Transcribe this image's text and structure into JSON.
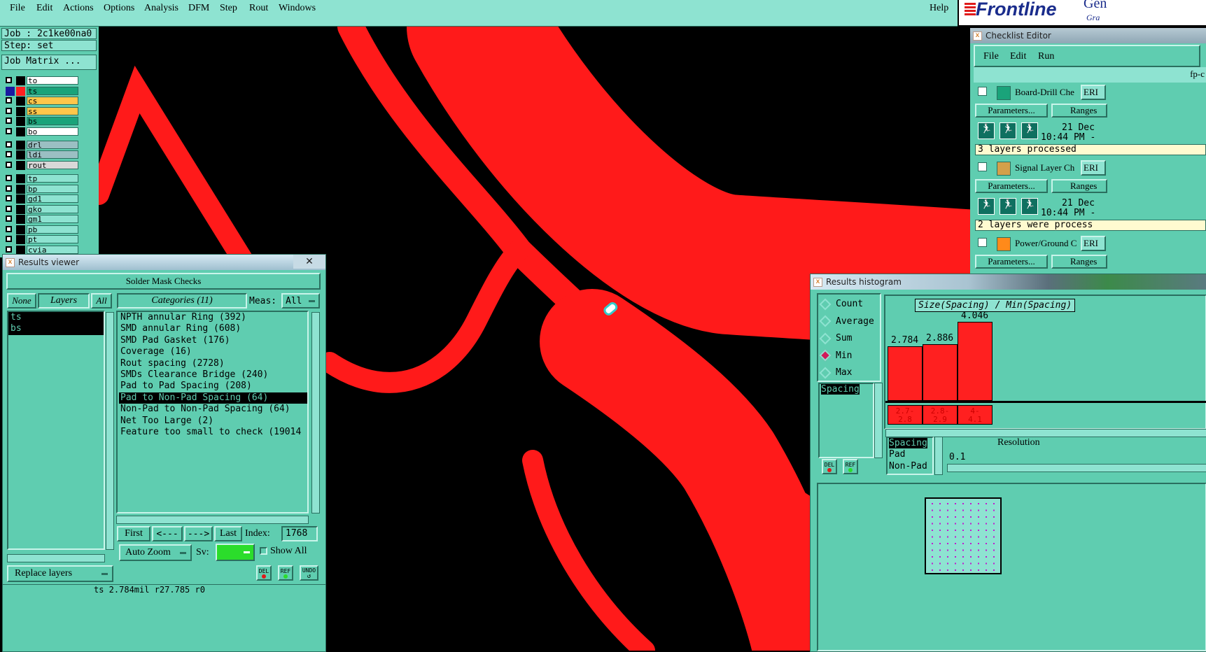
{
  "menu": {
    "file": "File",
    "edit": "Edit",
    "actions": "Actions",
    "options": "Options",
    "analysis": "Analysis",
    "dfm": "DFM",
    "step": "Step",
    "rout": "Rout",
    "windows": "Windows",
    "help": "Help"
  },
  "logo": {
    "brand": "Frontline",
    "g1": "Gen",
    "g2": "Gra"
  },
  "job": {
    "job_label": "Job : 2c1ke00na0",
    "step_label": "Step: set",
    "matrix_button": "Job Matrix ..."
  },
  "layers": [
    {
      "name": "to",
      "color": "#ffffff",
      "swatch": "#000000"
    },
    {
      "name": "ts",
      "color": "#1aa37a",
      "swatch": "#ff2020"
    },
    {
      "name": "cs",
      "color": "#ffc64a",
      "swatch": "#000000"
    },
    {
      "name": "ss",
      "color": "#ffc64a",
      "swatch": "#000000"
    },
    {
      "name": "bs",
      "color": "#1aa37a",
      "swatch": "#000000"
    },
    {
      "name": "bo",
      "color": "#ffffff",
      "swatch": "#000000"
    },
    {
      "name": "drl",
      "color": "#9bbfc3",
      "swatch": "#000000"
    },
    {
      "name": "ldi",
      "color": "#9bbfc3",
      "swatch": "#000000"
    },
    {
      "name": "rout",
      "color": "#d8d8d8",
      "swatch": "#000000"
    },
    {
      "name": "tp",
      "color": "#8ee3d1",
      "swatch": "#000000"
    },
    {
      "name": "bp",
      "color": "#8ee3d1",
      "swatch": "#000000"
    },
    {
      "name": "gd1",
      "color": "#8ee3d1",
      "swatch": "#000000"
    },
    {
      "name": "gko",
      "color": "#8ee3d1",
      "swatch": "#000000"
    },
    {
      "name": "gm1",
      "color": "#8ee3d1",
      "swatch": "#000000"
    },
    {
      "name": "pb",
      "color": "#8ee3d1",
      "swatch": "#000000"
    },
    {
      "name": "pt",
      "color": "#8ee3d1",
      "swatch": "#000000"
    },
    {
      "name": "cvia",
      "color": "#8ee3d1",
      "swatch": "#000000"
    }
  ],
  "results_viewer": {
    "title": "Results viewer",
    "heading": "Solder Mask Checks",
    "none_btn": "None",
    "layers_btn": "Layers",
    "all_btn": "All",
    "categories_btn": "Categories (11)",
    "meas_label": "Meas:",
    "meas_value": "All",
    "layers_list": [
      "ts",
      "bs"
    ],
    "categories": [
      "NPTH annular Ring (392)",
      "SMD annular Ring (608)",
      "SMD Pad Gasket (176)",
      "Coverage (16)",
      "Rout spacing (2728)",
      "SMDs Clearance Bridge (240)",
      "Pad to Pad Spacing (208)",
      "Pad to Non-Pad Spacing (64)",
      "Non-Pad to Non-Pad Spacing (64)",
      "Net Too Large (2)",
      "Feature too small to check (19014"
    ],
    "selected_category": 7,
    "first_btn": "First",
    "prev_btn": "<---",
    "next_btn": "--->",
    "last_btn": "Last",
    "index_label": "Index:",
    "index_value": "1768",
    "auto_zoom": "Auto Zoom",
    "sv_label": "Sv:",
    "show_all": "Show All",
    "replace_layers": "Replace layers",
    "del_btn": "DEL",
    "ref_btn": "REF",
    "undo_btn": "UNDO",
    "status": "ts 2.784mil r27.785 r0"
  },
  "checklist_editor": {
    "title": "Checklist Editor",
    "menu_file": "File",
    "menu_edit": "Edit",
    "menu_run": "Run",
    "checklist_name": "fp-c",
    "items": [
      {
        "name": "Board-Drill Che",
        "status_tag": "ERI",
        "params": "Parameters...",
        "ranges": "Ranges",
        "date": "21 Dec",
        "time": "10:44 PM -",
        "result": "3 layers processed"
      },
      {
        "name": "Signal Layer Ch",
        "status_tag": "ERI",
        "params": "Parameters...",
        "ranges": "Ranges",
        "date": "21 Dec",
        "time": "10:44 PM -",
        "result": "2 layers were process"
      },
      {
        "name": "Power/Ground C",
        "status_tag": "ERI",
        "params": "Parameters...",
        "ranges": "Ranges"
      }
    ]
  },
  "histogram": {
    "title": "Results histogram",
    "modes": [
      "Count",
      "Average",
      "Sum",
      "Min",
      "Max"
    ],
    "selected_mode": "Min",
    "attr_selected": "Spacing",
    "chart_title": "Size(Spacing) / Min(Spacing)",
    "bins": [
      {
        "value_label": "2.784",
        "value": 2.784,
        "range": [
          "2.7-",
          "2.8"
        ]
      },
      {
        "value_label": "2.886",
        "value": 2.886,
        "range": [
          "2.8-",
          "2.9"
        ]
      },
      {
        "value_label": "4.046",
        "value": 4.046,
        "range": [
          "4-",
          "4.1"
        ]
      }
    ],
    "types": [
      "Spacing",
      "Pad",
      "Non-Pad"
    ],
    "resolution_label": "Resolution",
    "resolution_value": "0.1",
    "del_btn": "DEL",
    "ref_btn": "REF"
  }
}
